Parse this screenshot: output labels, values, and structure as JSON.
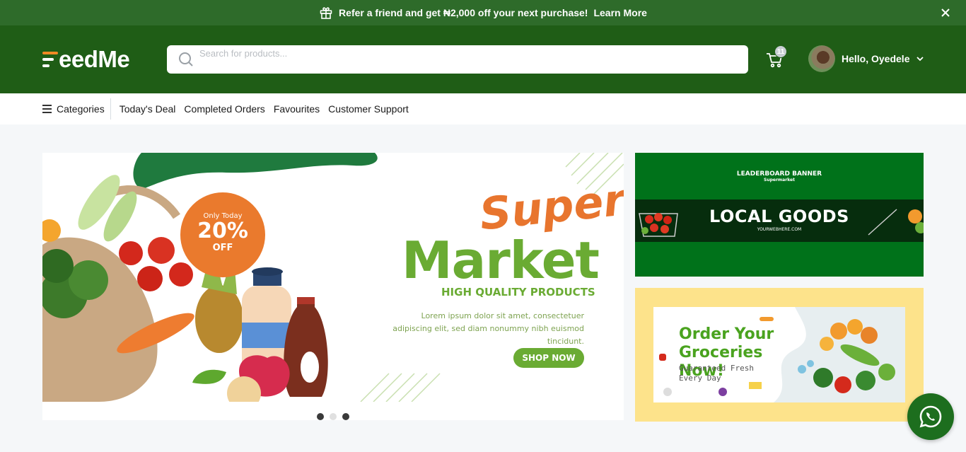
{
  "promo": {
    "text": "Refer a friend and get ₦2,000 off your next purchase!",
    "link": "Learn More"
  },
  "header": {
    "logo_text": "eedMe",
    "search_placeholder": "Search for products...",
    "cart_count": "11",
    "user_greeting": "Hello, Oyedele"
  },
  "nav": {
    "categories": "Categories",
    "items": [
      "Today's Deal",
      "Completed Orders",
      "Favourites",
      "Customer Support"
    ]
  },
  "hero": {
    "badge_top": "Only Today",
    "badge_percent": "20%",
    "badge_off": "OFF",
    "title_script": "Super",
    "title": "Market",
    "subtitle": "HIGH QUALITY PRODUCTS",
    "body": "Lorem ipsum dolor sit amet, consectetuer adipiscing elit, sed diam nonummy nibh euismod tincidunt.",
    "cta": "SHOP NOW",
    "slide_count": 3,
    "active_slide": 1
  },
  "side_banner_1": {
    "title": "LEADERBOARD BANNER",
    "subtitle": "Supermarket",
    "headline": "LOCAL GOODS",
    "url": "YOURWEBHERE.COM"
  },
  "side_banner_2": {
    "headline": "Order Your Groceries Now!",
    "tagline": "Guaranteed Fresh Every Day"
  },
  "colors": {
    "promo_bg": "#2e6b2a",
    "header_bg": "#1f5d16",
    "accent_green": "#6aab33",
    "accent_orange": "#ea7a2d",
    "whatsapp_bg": "#1d6e1e"
  }
}
